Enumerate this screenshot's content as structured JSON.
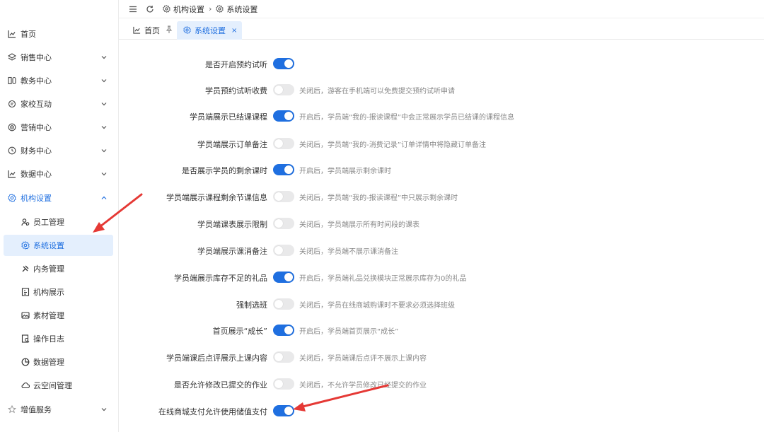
{
  "sidebar": {
    "items": [
      {
        "label": "首页",
        "icon": "chart-icon",
        "expandable": false
      },
      {
        "label": "销售中心",
        "icon": "layers-icon",
        "expandable": true
      },
      {
        "label": "教务中心",
        "icon": "book-icon",
        "expandable": true
      },
      {
        "label": "家校互动",
        "icon": "chat-icon",
        "expandable": true
      },
      {
        "label": "营销中心",
        "icon": "target-icon",
        "expandable": true
      },
      {
        "label": "财务中心",
        "icon": "clock-icon",
        "expandable": true
      },
      {
        "label": "数据中心",
        "icon": "chart-icon",
        "expandable": true
      },
      {
        "label": "机构设置",
        "icon": "gear-icon",
        "expandable": true,
        "expanded": true
      }
    ],
    "sub_items": [
      {
        "label": "员工管理",
        "icon": "people-icon"
      },
      {
        "label": "系统设置",
        "icon": "gear-icon",
        "active": true
      },
      {
        "label": "内务管理",
        "icon": "tools-icon"
      },
      {
        "label": "机构展示",
        "icon": "display-icon"
      },
      {
        "label": "素材管理",
        "icon": "image-icon"
      },
      {
        "label": "操作日志",
        "icon": "log-icon"
      },
      {
        "label": "数据管理",
        "icon": "pie-icon"
      },
      {
        "label": "云空间管理",
        "icon": "cloud-icon"
      }
    ],
    "bottom_item": {
      "label": "增值服务",
      "icon": "star-icon",
      "expandable": true
    }
  },
  "topbar": {
    "breadcrumb": [
      "机构设置",
      "系统设置"
    ]
  },
  "tabs": {
    "home": "首页",
    "active": "系统设置",
    "close": "×"
  },
  "settings": [
    {
      "label": "是否开启预约试听",
      "on": true,
      "desc": ""
    },
    {
      "label": "学员预约试听收费",
      "on": false,
      "desc": "关闭后，游客在手机端可以免费提交预约试听申请"
    },
    {
      "label": "学员端展示已结课课程",
      "on": true,
      "desc": "开启后，学员端“我的-报读课程”中会正常展示学员已结课的课程信息"
    },
    {
      "label": "学员端展示订单备注",
      "on": false,
      "desc": "关闭后，学员端“我的-消费记录”订单详情中将隐藏订单备注"
    },
    {
      "label": "是否展示学员的剩余课时",
      "on": true,
      "desc": "开启后，学员端展示剩余课时"
    },
    {
      "label": "学员端展示课程剩余节课信息",
      "on": false,
      "desc": "关闭后，学员端“我的-报读课程”中只展示剩余课时"
    },
    {
      "label": "学员端课表展示限制",
      "on": false,
      "desc": "关闭后，学员端展示所有时间段的课表"
    },
    {
      "label": "学员端展示课消备注",
      "on": false,
      "desc": "关闭后，学员端不展示课消备注"
    },
    {
      "label": "学员端展示库存不足的礼品",
      "on": true,
      "desc": "开启后，学员端礼品兑换模块正常展示库存为0的礼品"
    },
    {
      "label": "强制选班",
      "on": false,
      "desc": "关闭后，学员在线商城购课时不要求必须选择班级"
    },
    {
      "label": "首页展示“成长”",
      "on": true,
      "desc": "开启后，学员端首页展示“成长”"
    },
    {
      "label": "学员端课后点评展示上课内容",
      "on": false,
      "desc": "关闭后，学员端课后点评不展示上课内容"
    },
    {
      "label": "是否允许修改已提交的作业",
      "on": false,
      "desc": "关闭后，不允许学员修改已经提交的作业"
    },
    {
      "label": "在线商城支付允许使用储值支付",
      "on": true,
      "desc": ""
    }
  ],
  "colors": {
    "accent": "#1f6fe0",
    "active_bg": "#e4effd",
    "annotation": "#e53935"
  }
}
